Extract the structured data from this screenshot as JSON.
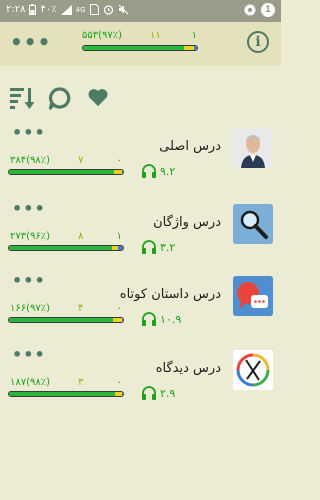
{
  "status_bar": {
    "time": "۲:۲۸",
    "battery": "۴۰٪",
    "network": "4G",
    "notification_count": "1"
  },
  "header": {
    "more_label": "•••",
    "info_label": "i",
    "stats": {
      "total": "۵۵۳(۹۷٪)",
      "pending": "۱۱",
      "new": "۱"
    },
    "progress": {
      "done": 0.89,
      "pending": 0.08,
      "new": 0.03
    }
  },
  "toolbar": {
    "sort_icon": "sort-descending-icon",
    "comment_icon": "chat-bubble-icon",
    "favorite_icon": "heart-icon"
  },
  "lessons": [
    {
      "title": "درس اصلی",
      "stats": {
        "total": "۳۸۴(۹۸٪)",
        "pending": "۷",
        "new": "۰"
      },
      "duration": "۹.۲",
      "progress": {
        "done": 0.92,
        "pending": 0.07,
        "new": 0.01
      },
      "thumb": "portrait"
    },
    {
      "title": "درس واژگان",
      "stats": {
        "total": "۲۷۳(۹۶٪)",
        "pending": "۸",
        "new": "۱"
      },
      "duration": "۳.۲",
      "progress": {
        "done": 0.9,
        "pending": 0.06,
        "new": 0.04
      },
      "thumb": "magnifier"
    },
    {
      "title": "درس داستان کوتاه",
      "stats": {
        "total": "۱۶۶(۹۷٪)",
        "pending": "۴",
        "new": "۰"
      },
      "duration": "۱۰.۹",
      "progress": {
        "done": 0.91,
        "pending": 0.08,
        "new": 0.01
      },
      "thumb": "speech"
    },
    {
      "title": "درس دیدگاه",
      "stats": {
        "total": "۱۸۷(۹۸٪)",
        "pending": "۳",
        "new": "۰"
      },
      "duration": "۲.۹",
      "progress": {
        "done": 0.93,
        "pending": 0.06,
        "new": 0.01
      },
      "thumb": "diagram"
    }
  ],
  "colors": {
    "accent": "#4d7b66",
    "green_text": "#1aa21a",
    "yellow_text": "#a8a800",
    "bar_green": "#27b83a",
    "bar_yellow": "#e6d21f",
    "bar_blue": "#3d7bd3"
  }
}
